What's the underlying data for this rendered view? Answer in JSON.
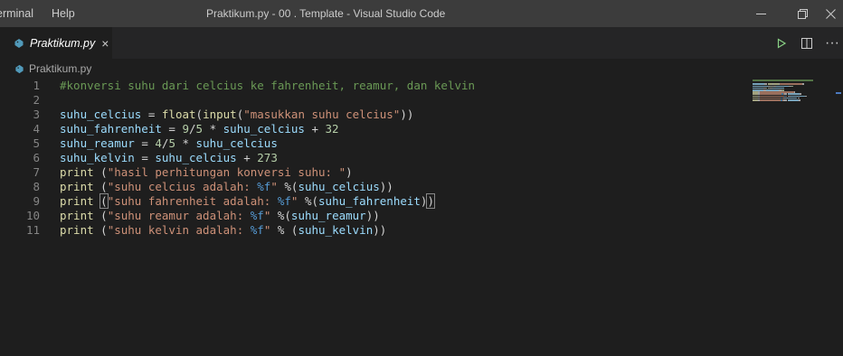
{
  "menu": {
    "terminal_label": "erminal",
    "help_label": "Help"
  },
  "window": {
    "title": "Praktikum.py - 00 . Template - Visual Studio Code"
  },
  "tab": {
    "label": "Praktikum.py",
    "close_glyph": "×"
  },
  "actions": {
    "more_glyph": "···"
  },
  "breadcrumb": {
    "file": "Praktikum.py"
  },
  "editor": {
    "lines": [
      {
        "num": "1",
        "tokens": [
          {
            "t": "#konversi suhu dari celcius ke fahrenheit, reamur, dan kelvin",
            "c": "comment"
          }
        ]
      },
      {
        "num": "2",
        "tokens": []
      },
      {
        "num": "3",
        "tokens": [
          {
            "t": "suhu_celcius",
            "c": "var"
          },
          {
            "t": " = ",
            "c": "op"
          },
          {
            "t": "float",
            "c": "fn"
          },
          {
            "t": "(",
            "c": "op"
          },
          {
            "t": "input",
            "c": "fn"
          },
          {
            "t": "(",
            "c": "op"
          },
          {
            "t": "\"masukkan suhu celcius\"",
            "c": "str"
          },
          {
            "t": "))",
            "c": "op"
          }
        ]
      },
      {
        "num": "4",
        "tokens": [
          {
            "t": "suhu_fahrenheit",
            "c": "var"
          },
          {
            "t": " = ",
            "c": "op"
          },
          {
            "t": "9",
            "c": "num"
          },
          {
            "t": "/",
            "c": "op"
          },
          {
            "t": "5",
            "c": "num"
          },
          {
            "t": " * ",
            "c": "op"
          },
          {
            "t": "suhu_celcius",
            "c": "var"
          },
          {
            "t": " + ",
            "c": "op"
          },
          {
            "t": "32",
            "c": "num"
          }
        ]
      },
      {
        "num": "5",
        "tokens": [
          {
            "t": "suhu_reamur",
            "c": "var"
          },
          {
            "t": " = ",
            "c": "op"
          },
          {
            "t": "4",
            "c": "num"
          },
          {
            "t": "/",
            "c": "op"
          },
          {
            "t": "5",
            "c": "num"
          },
          {
            "t": " * ",
            "c": "op"
          },
          {
            "t": "suhu_celcius",
            "c": "var"
          }
        ]
      },
      {
        "num": "6",
        "tokens": [
          {
            "t": "suhu_kelvin",
            "c": "var"
          },
          {
            "t": " = ",
            "c": "op"
          },
          {
            "t": "suhu_celcius",
            "c": "var"
          },
          {
            "t": " + ",
            "c": "op"
          },
          {
            "t": "273",
            "c": "num"
          }
        ]
      },
      {
        "num": "7",
        "tokens": [
          {
            "t": "print",
            "c": "fn"
          },
          {
            "t": " (",
            "c": "op"
          },
          {
            "t": "\"hasil perhitungan konversi suhu: \"",
            "c": "str"
          },
          {
            "t": ")",
            "c": "op"
          }
        ]
      },
      {
        "num": "8",
        "tokens": [
          {
            "t": "print",
            "c": "fn"
          },
          {
            "t": " (",
            "c": "op"
          },
          {
            "t": "\"suhu celcius adalah: ",
            "c": "str"
          },
          {
            "t": "%f",
            "c": "fmt"
          },
          {
            "t": "\"",
            "c": "str"
          },
          {
            "t": " %(",
            "c": "op"
          },
          {
            "t": "suhu_celcius",
            "c": "var"
          },
          {
            "t": "))",
            "c": "op"
          }
        ]
      },
      {
        "num": "9",
        "tokens": [
          {
            "t": "print",
            "c": "fn"
          },
          {
            "t": " ",
            "c": "op"
          },
          {
            "t": "(",
            "c": "op",
            "m": true
          },
          {
            "t": "\"suhu fahrenheit adalah: ",
            "c": "str"
          },
          {
            "t": "%f",
            "c": "fmt"
          },
          {
            "t": "\"",
            "c": "str"
          },
          {
            "t": " %(",
            "c": "op"
          },
          {
            "t": "suhu_fahrenheit",
            "c": "var"
          },
          {
            "t": ")",
            "c": "op"
          },
          {
            "t": ")",
            "c": "op",
            "m": true
          }
        ]
      },
      {
        "num": "10",
        "tokens": [
          {
            "t": "print",
            "c": "fn"
          },
          {
            "t": " (",
            "c": "op"
          },
          {
            "t": "\"suhu reamur adalah: ",
            "c": "str"
          },
          {
            "t": "%f",
            "c": "fmt"
          },
          {
            "t": "\"",
            "c": "str"
          },
          {
            "t": " %(",
            "c": "op"
          },
          {
            "t": "suhu_reamur",
            "c": "var"
          },
          {
            "t": "))",
            "c": "op"
          }
        ]
      },
      {
        "num": "11",
        "tokens": [
          {
            "t": "print",
            "c": "fn"
          },
          {
            "t": " (",
            "c": "op"
          },
          {
            "t": "\"suhu kelvin adalah: ",
            "c": "str"
          },
          {
            "t": "%f",
            "c": "fmt"
          },
          {
            "t": "\"",
            "c": "str"
          },
          {
            "t": " % (",
            "c": "op"
          },
          {
            "t": "suhu_kelvin",
            "c": "var"
          },
          {
            "t": "))",
            "c": "op"
          }
        ]
      }
    ]
  },
  "colors": {
    "comment": "#6a9955",
    "var": "#9cdcfe",
    "fn": "#dcdcaa",
    "str": "#ce9178",
    "num": "#b5cea8",
    "op": "#d4d4d4",
    "fmt": "#569cd6"
  }
}
